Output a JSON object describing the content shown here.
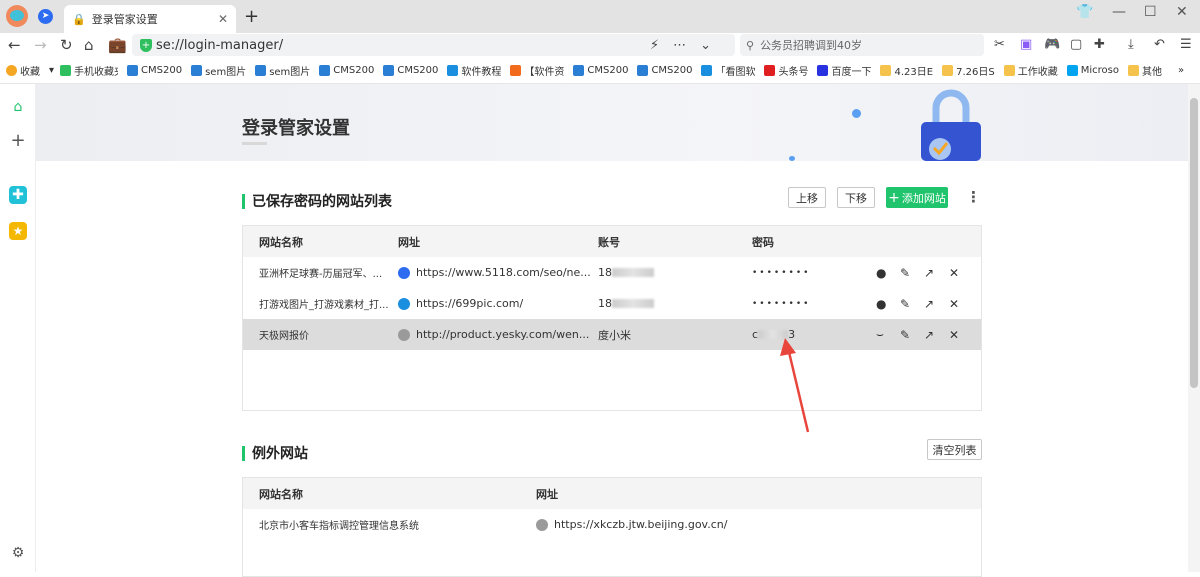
{
  "browser": {
    "tab_title": "登录管家设置",
    "address": "se://login-manager/",
    "search_placeholder": "公务员招聘调到40岁",
    "bookmarks": [
      {
        "label": "收藏",
        "color": "#f5a623"
      },
      {
        "label": "手机收藏夹",
        "color": "#2fbf5f"
      },
      {
        "label": "CMS200",
        "color": "#2a7fd4"
      },
      {
        "label": "sem图片",
        "color": "#2a7fd4"
      },
      {
        "label": "sem图片",
        "color": "#2a7fd4"
      },
      {
        "label": "CMS200",
        "color": "#2a7fd4"
      },
      {
        "label": "CMS200",
        "color": "#2a7fd4"
      },
      {
        "label": "软件教程",
        "color": "#1a8fe0"
      },
      {
        "label": "【软件资",
        "color": "#f26b1d"
      },
      {
        "label": "CMS200",
        "color": "#2a7fd4"
      },
      {
        "label": "CMS200",
        "color": "#2a7fd4"
      },
      {
        "label": "「看图软",
        "color": "#1a8fe0"
      },
      {
        "label": "头条号",
        "color": "#e02020"
      },
      {
        "label": "百度一下",
        "color": "#2932e1"
      },
      {
        "label": "4.23日E",
        "color": "#f5c24c"
      },
      {
        "label": "7.26日S",
        "color": "#f5c24c"
      },
      {
        "label": "工作收藏",
        "color": "#f5c24c"
      },
      {
        "label": "Microso",
        "color": "#00a4ef"
      },
      {
        "label": "其他",
        "color": "#f5c24c"
      }
    ],
    "more_bookmarks": "»"
  },
  "page": {
    "title": "登录管家设置",
    "saved": {
      "title": "已保存密码的网站列表",
      "move_up": "上移",
      "move_down": "下移",
      "add_site": "添加网站",
      "headers": [
        "网站名称",
        "网址",
        "账号",
        "密码"
      ],
      "rows": [
        {
          "name": "亚洲杯足球赛-历届冠军、...",
          "url": "https://www.5118.com/seo/ne...",
          "account": "18",
          "password": "••••••••",
          "fav": "#2d6cf0",
          "selected": false
        },
        {
          "name": "打游戏图片_打游戏素材_打...",
          "url": "https://699pic.com/",
          "account": "18",
          "password": "••••••••",
          "fav": "#1a8fe0",
          "selected": false
        },
        {
          "name": "天极网报价",
          "url": "http://product.yesky.com/wen...",
          "account": "度小米",
          "password": "c",
          "password_end": "3",
          "fav": "#9a9a9a",
          "selected": true
        }
      ]
    },
    "exceptions": {
      "title": "例外网站",
      "clear": "清空列表",
      "headers": [
        "网站名称",
        "网址"
      ],
      "rows": [
        {
          "name": "北京市小客车指标调控管理信息系统",
          "url": "https://xkczb.jtw.beijing.gov.cn/"
        }
      ]
    }
  },
  "colors": {
    "accent": "#1fc46c",
    "arrow": "#e8453c"
  }
}
